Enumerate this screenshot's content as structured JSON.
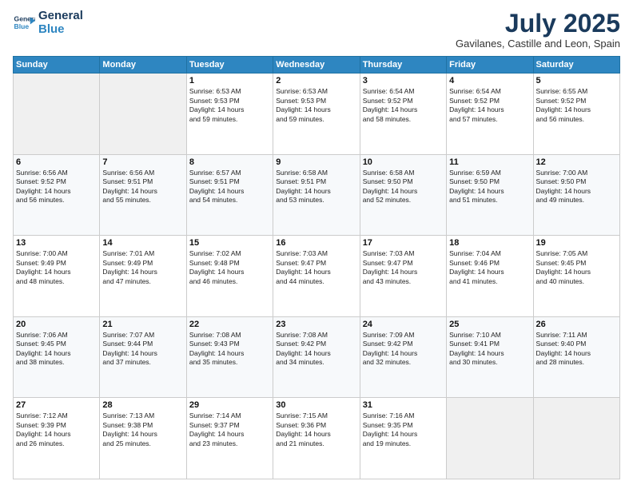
{
  "header": {
    "logo_line1": "General",
    "logo_line2": "Blue",
    "month": "July 2025",
    "location": "Gavilanes, Castille and Leon, Spain"
  },
  "weekdays": [
    "Sunday",
    "Monday",
    "Tuesday",
    "Wednesday",
    "Thursday",
    "Friday",
    "Saturday"
  ],
  "rows": [
    [
      {
        "day": "",
        "text": ""
      },
      {
        "day": "",
        "text": ""
      },
      {
        "day": "1",
        "text": "Sunrise: 6:53 AM\nSunset: 9:53 PM\nDaylight: 14 hours\nand 59 minutes."
      },
      {
        "day": "2",
        "text": "Sunrise: 6:53 AM\nSunset: 9:53 PM\nDaylight: 14 hours\nand 59 minutes."
      },
      {
        "day": "3",
        "text": "Sunrise: 6:54 AM\nSunset: 9:52 PM\nDaylight: 14 hours\nand 58 minutes."
      },
      {
        "day": "4",
        "text": "Sunrise: 6:54 AM\nSunset: 9:52 PM\nDaylight: 14 hours\nand 57 minutes."
      },
      {
        "day": "5",
        "text": "Sunrise: 6:55 AM\nSunset: 9:52 PM\nDaylight: 14 hours\nand 56 minutes."
      }
    ],
    [
      {
        "day": "6",
        "text": "Sunrise: 6:56 AM\nSunset: 9:52 PM\nDaylight: 14 hours\nand 56 minutes."
      },
      {
        "day": "7",
        "text": "Sunrise: 6:56 AM\nSunset: 9:51 PM\nDaylight: 14 hours\nand 55 minutes."
      },
      {
        "day": "8",
        "text": "Sunrise: 6:57 AM\nSunset: 9:51 PM\nDaylight: 14 hours\nand 54 minutes."
      },
      {
        "day": "9",
        "text": "Sunrise: 6:58 AM\nSunset: 9:51 PM\nDaylight: 14 hours\nand 53 minutes."
      },
      {
        "day": "10",
        "text": "Sunrise: 6:58 AM\nSunset: 9:50 PM\nDaylight: 14 hours\nand 52 minutes."
      },
      {
        "day": "11",
        "text": "Sunrise: 6:59 AM\nSunset: 9:50 PM\nDaylight: 14 hours\nand 51 minutes."
      },
      {
        "day": "12",
        "text": "Sunrise: 7:00 AM\nSunset: 9:50 PM\nDaylight: 14 hours\nand 49 minutes."
      }
    ],
    [
      {
        "day": "13",
        "text": "Sunrise: 7:00 AM\nSunset: 9:49 PM\nDaylight: 14 hours\nand 48 minutes."
      },
      {
        "day": "14",
        "text": "Sunrise: 7:01 AM\nSunset: 9:49 PM\nDaylight: 14 hours\nand 47 minutes."
      },
      {
        "day": "15",
        "text": "Sunrise: 7:02 AM\nSunset: 9:48 PM\nDaylight: 14 hours\nand 46 minutes."
      },
      {
        "day": "16",
        "text": "Sunrise: 7:03 AM\nSunset: 9:47 PM\nDaylight: 14 hours\nand 44 minutes."
      },
      {
        "day": "17",
        "text": "Sunrise: 7:03 AM\nSunset: 9:47 PM\nDaylight: 14 hours\nand 43 minutes."
      },
      {
        "day": "18",
        "text": "Sunrise: 7:04 AM\nSunset: 9:46 PM\nDaylight: 14 hours\nand 41 minutes."
      },
      {
        "day": "19",
        "text": "Sunrise: 7:05 AM\nSunset: 9:45 PM\nDaylight: 14 hours\nand 40 minutes."
      }
    ],
    [
      {
        "day": "20",
        "text": "Sunrise: 7:06 AM\nSunset: 9:45 PM\nDaylight: 14 hours\nand 38 minutes."
      },
      {
        "day": "21",
        "text": "Sunrise: 7:07 AM\nSunset: 9:44 PM\nDaylight: 14 hours\nand 37 minutes."
      },
      {
        "day": "22",
        "text": "Sunrise: 7:08 AM\nSunset: 9:43 PM\nDaylight: 14 hours\nand 35 minutes."
      },
      {
        "day": "23",
        "text": "Sunrise: 7:08 AM\nSunset: 9:42 PM\nDaylight: 14 hours\nand 34 minutes."
      },
      {
        "day": "24",
        "text": "Sunrise: 7:09 AM\nSunset: 9:42 PM\nDaylight: 14 hours\nand 32 minutes."
      },
      {
        "day": "25",
        "text": "Sunrise: 7:10 AM\nSunset: 9:41 PM\nDaylight: 14 hours\nand 30 minutes."
      },
      {
        "day": "26",
        "text": "Sunrise: 7:11 AM\nSunset: 9:40 PM\nDaylight: 14 hours\nand 28 minutes."
      }
    ],
    [
      {
        "day": "27",
        "text": "Sunrise: 7:12 AM\nSunset: 9:39 PM\nDaylight: 14 hours\nand 26 minutes."
      },
      {
        "day": "28",
        "text": "Sunrise: 7:13 AM\nSunset: 9:38 PM\nDaylight: 14 hours\nand 25 minutes."
      },
      {
        "day": "29",
        "text": "Sunrise: 7:14 AM\nSunset: 9:37 PM\nDaylight: 14 hours\nand 23 minutes."
      },
      {
        "day": "30",
        "text": "Sunrise: 7:15 AM\nSunset: 9:36 PM\nDaylight: 14 hours\nand 21 minutes."
      },
      {
        "day": "31",
        "text": "Sunrise: 7:16 AM\nSunset: 9:35 PM\nDaylight: 14 hours\nand 19 minutes."
      },
      {
        "day": "",
        "text": ""
      },
      {
        "day": "",
        "text": ""
      }
    ]
  ]
}
